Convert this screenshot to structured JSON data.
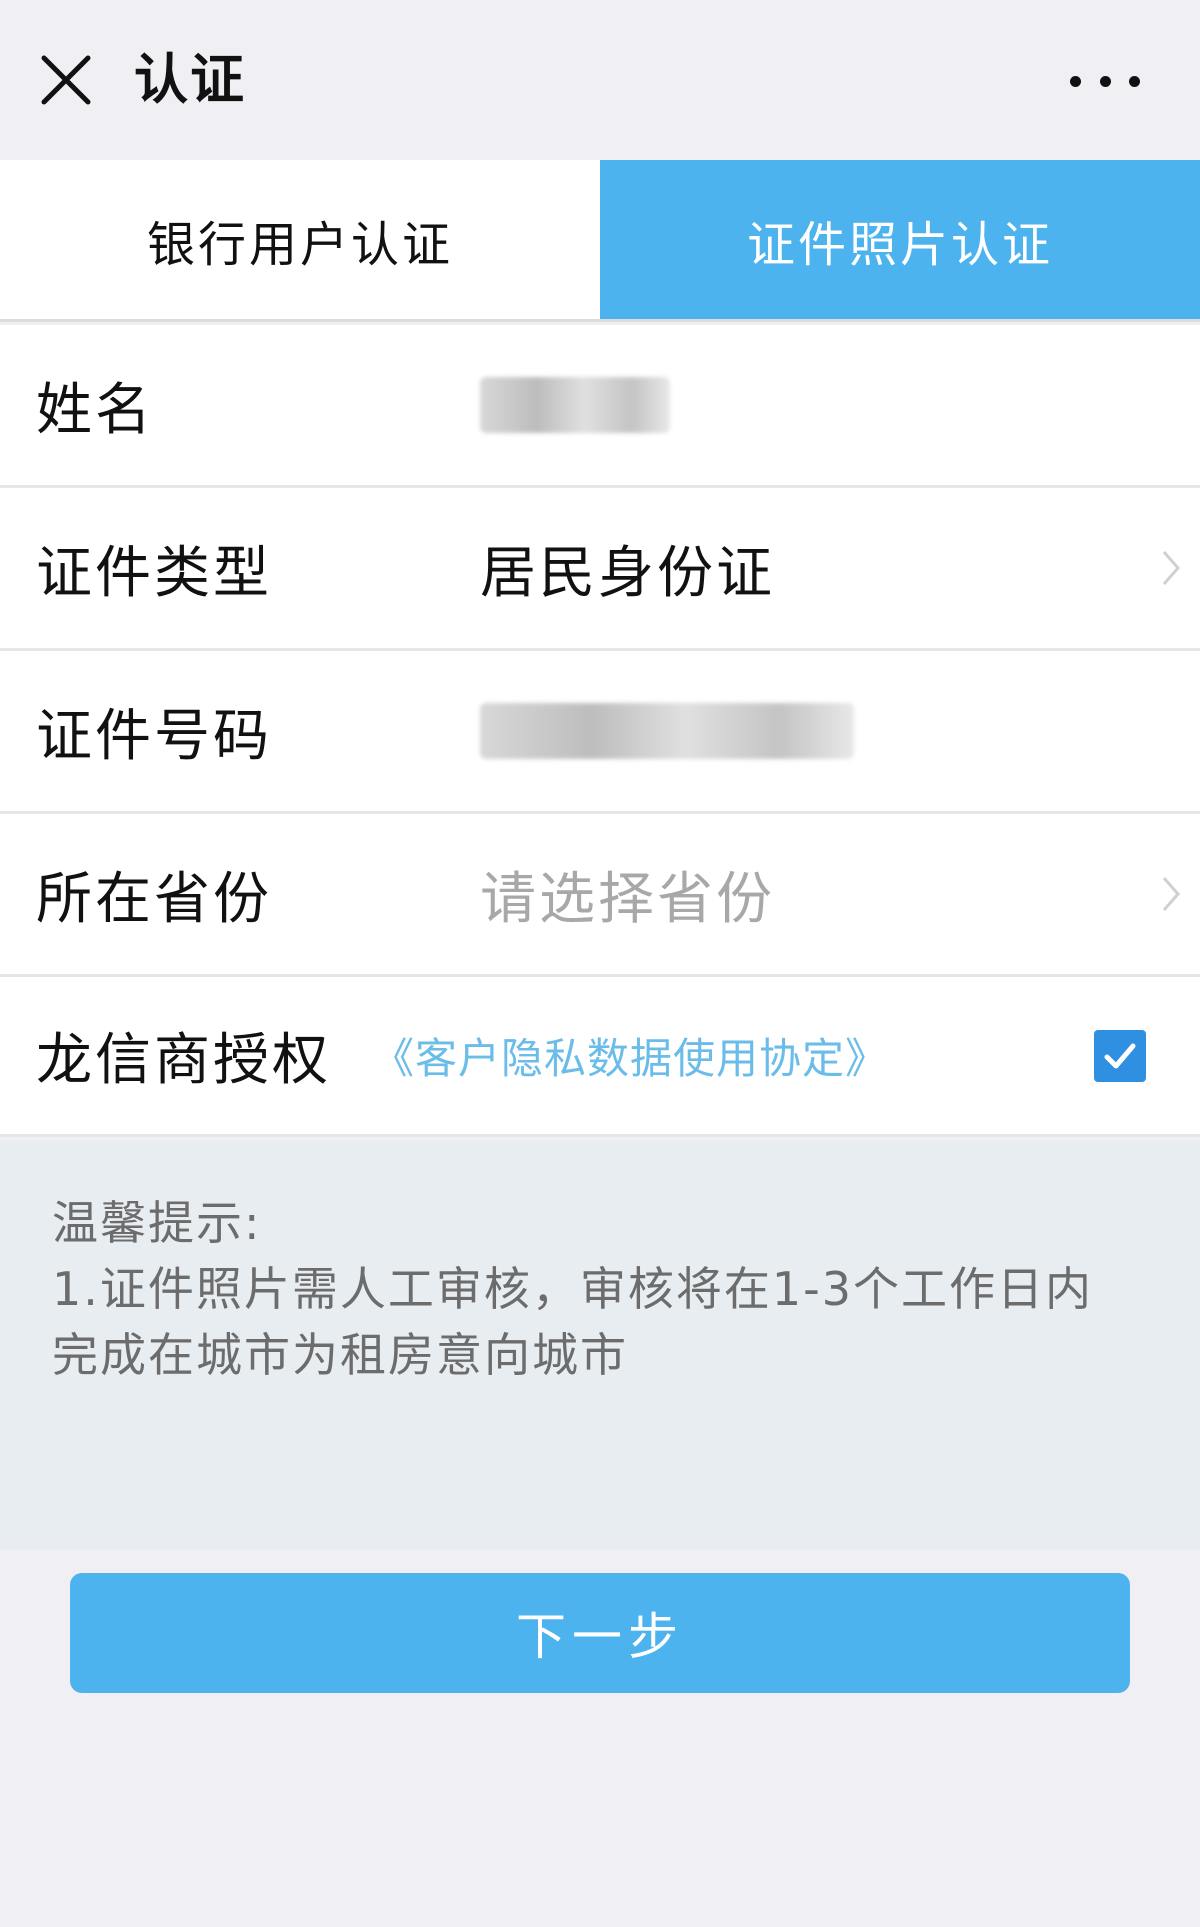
{
  "titlebar": {
    "title": "认证",
    "close_icon": "close-icon",
    "more_icon": "more-icon"
  },
  "tabs": [
    {
      "label": "银行用户认证",
      "active": false
    },
    {
      "label": "证件照片认证",
      "active": true
    }
  ],
  "form": {
    "name": {
      "label": "姓名"
    },
    "id_type": {
      "label": "证件类型",
      "value": "居民身份证"
    },
    "id_number": {
      "label": "证件号码"
    },
    "province": {
      "label": "所在省份",
      "placeholder": "请选择省份"
    },
    "authorization": {
      "label": "龙信商授权",
      "link": "《客户隐私数据使用协定》",
      "checked": true
    }
  },
  "tips": {
    "title": "温馨提示:",
    "line1": "1.证件照片需人工审核，审核将在1-3个工作日内",
    "line2": "完成在城市为租房意向城市"
  },
  "next_button": {
    "label": "下一步"
  },
  "colors": {
    "accent": "#4db3ee",
    "link": "#6bbde9",
    "checkbox": "#2f8fe0",
    "background": "#efeff4"
  }
}
